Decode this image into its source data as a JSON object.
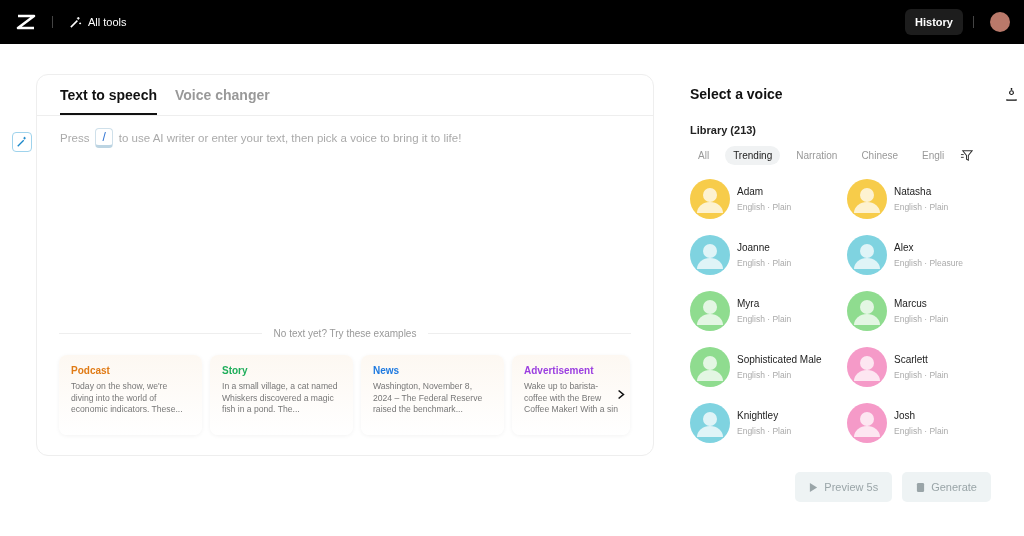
{
  "header": {
    "all_tools": "All tools",
    "history": "History"
  },
  "editor": {
    "tabs": [
      {
        "label": "Text to speech",
        "selected": true
      },
      {
        "label": "Voice changer",
        "selected": false
      }
    ],
    "hint_before": "Press",
    "key": "/",
    "hint_after": "to use AI writer or enter your text, then pick a voice to bring it to life!",
    "examples_label": "No text yet? Try these examples",
    "examples": [
      {
        "title": "Podcast",
        "color": "#e07b16",
        "text": "Today on the show, we're diving into the world of economic indicators. These..."
      },
      {
        "title": "Story",
        "color": "#1fae5b",
        "text": "In a small village, a cat named Whiskers discovered a magic fish in a pond. The..."
      },
      {
        "title": "News",
        "color": "#1f7ae0",
        "text": "Washington, November 8, 2024 – The Federal Reserve raised the benchmark..."
      },
      {
        "title": "Advertisement",
        "color": "#9b3fe0",
        "text": "Wake up to barista- coffee with the Brew Coffee Maker! With a sin"
      }
    ]
  },
  "voices": {
    "title": "Select a voice",
    "library": "Library (213)",
    "filters": [
      {
        "label": "All",
        "selected": false
      },
      {
        "label": "Trending",
        "selected": true
      },
      {
        "label": "Narration",
        "selected": false
      },
      {
        "label": "Chinese",
        "selected": false
      },
      {
        "label": "Engli",
        "selected": false
      }
    ],
    "items": [
      {
        "name": "Adam",
        "meta": "English · Plain",
        "color": "#f7cc4a"
      },
      {
        "name": "Natasha",
        "meta": "English · Plain",
        "color": "#f7cc4a"
      },
      {
        "name": "Joanne",
        "meta": "English · Plain",
        "color": "#7fd3e0"
      },
      {
        "name": "Alex",
        "meta": "English · Pleasure",
        "color": "#7fd3e0"
      },
      {
        "name": "Myra",
        "meta": "English · Plain",
        "color": "#8fdc8f"
      },
      {
        "name": "Marcus",
        "meta": "English · Plain",
        "color": "#8fdc8f"
      },
      {
        "name": "Sophisticated Male",
        "meta": "English · Plain",
        "color": "#8fdc8f"
      },
      {
        "name": "Scarlett",
        "meta": "English · Plain",
        "color": "#f59ac8"
      },
      {
        "name": "Knightley",
        "meta": "English · Plain",
        "color": "#7fd3e0"
      },
      {
        "name": "Josh",
        "meta": "English · Plain",
        "color": "#f59ac8"
      }
    ],
    "buttons": [
      {
        "label": "Preview 5s",
        "kind": "play",
        "disabled": true
      },
      {
        "label": "Generate",
        "kind": "generate",
        "disabled": true
      }
    ]
  }
}
